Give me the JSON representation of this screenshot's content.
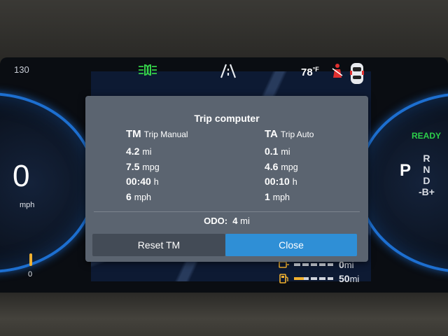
{
  "header": {
    "speed_limit": "130",
    "temperature": "78",
    "temp_unit": "°F"
  },
  "speedometer": {
    "speed": "0",
    "unit": "mph",
    "fuel_zero": "0"
  },
  "drive": {
    "ready": "READY",
    "current_gear": "P",
    "gears": [
      "R",
      "N",
      "D",
      "-B+"
    ]
  },
  "range": {
    "row1": {
      "value": "0",
      "unit": "mi"
    },
    "row2": {
      "value": "50",
      "unit": "mi"
    }
  },
  "dialog": {
    "title": "Trip computer",
    "trip_manual": {
      "code": "TM",
      "label": "Trip Manual",
      "distance": {
        "value": "4.2",
        "unit": "mi"
      },
      "economy": {
        "value": "7.5",
        "unit": "mpg"
      },
      "time": {
        "value": "00:40",
        "unit": "h"
      },
      "speed": {
        "value": "6",
        "unit": "mph"
      }
    },
    "trip_auto": {
      "code": "TA",
      "label": "Trip Auto",
      "distance": {
        "value": "0.1",
        "unit": "mi"
      },
      "economy": {
        "value": "4.6",
        "unit": "mpg"
      },
      "time": {
        "value": "00:10",
        "unit": "h"
      },
      "speed": {
        "value": "1",
        "unit": "mph"
      }
    },
    "odo": {
      "label": "ODO:",
      "value": "4",
      "unit": "mi"
    },
    "buttons": {
      "reset": "Reset TM",
      "close": "Close"
    }
  },
  "colors": {
    "accent_blue": "#2f8fd6",
    "ready_green": "#2ccf4a",
    "warning_red": "#e03030",
    "light_green": "#35d04a",
    "fuel_amber": "#f0b030"
  }
}
